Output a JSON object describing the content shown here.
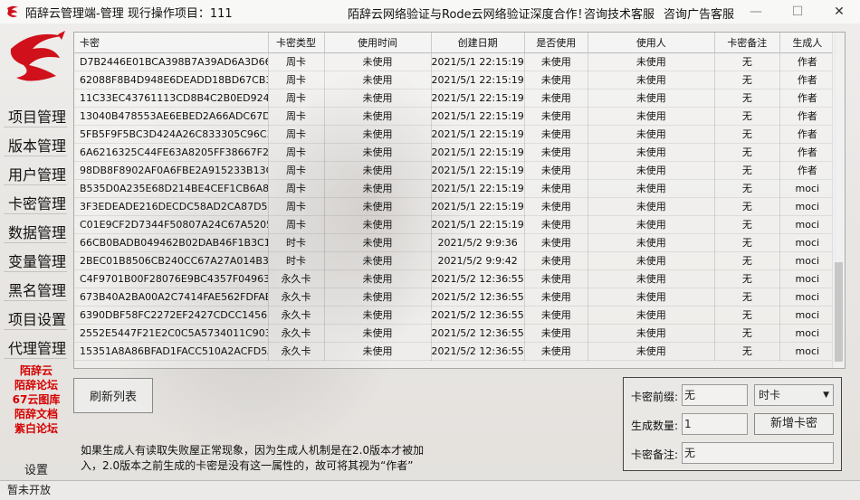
{
  "window": {
    "title": "陌辞云管理端-管理 现行操作项目：111",
    "banner": "陌辞云网络验证与Rode云网络验证深度合作！",
    "support_link": "咨询技术客服",
    "ads_link": "咨询广告客服",
    "minimize": "—",
    "maximize": "☐",
    "close": "✕"
  },
  "sidebar": {
    "items": [
      "项目管理",
      "版本管理",
      "用户管理",
      "卡密管理",
      "数据管理",
      "变量管理",
      "黑名管理",
      "项目设置",
      "代理管理"
    ],
    "links": [
      "陌辞云",
      "陌辞论坛",
      "67云图库",
      "陌辞文档",
      "紫白论坛"
    ],
    "settings": "设置"
  },
  "table": {
    "columns": [
      "卡密",
      "卡密类型",
      "使用时间",
      "创建日期",
      "是否使用",
      "使用人",
      "卡密备注",
      "生成人"
    ],
    "rows": [
      [
        "D7B2446E01BCA398B7A39AD6A3D668F5",
        "周卡",
        "未使用",
        "2021/5/1 22:15:19",
        "未使用",
        "未使用",
        "无",
        "作者"
      ],
      [
        "62088F8B4D948E6DEADD18BD67CB34D…",
        "周卡",
        "未使用",
        "2021/5/1 22:15:19",
        "未使用",
        "未使用",
        "无",
        "作者"
      ],
      [
        "11C33EC43761113CD8B4C2B0ED924091",
        "周卡",
        "未使用",
        "2021/5/1 22:15:19",
        "未使用",
        "未使用",
        "无",
        "作者"
      ],
      [
        "13040B478553AE6EBED2A66ADC67D1ED",
        "周卡",
        "未使用",
        "2021/5/1 22:15:19",
        "未使用",
        "未使用",
        "无",
        "作者"
      ],
      [
        "5FB5F9F5BC3D424A26C833305C96C386",
        "周卡",
        "未使用",
        "2021/5/1 22:15:19",
        "未使用",
        "未使用",
        "无",
        "作者"
      ],
      [
        "6A6216325C44FE63A8205FF38667F2DA",
        "周卡",
        "未使用",
        "2021/5/1 22:15:19",
        "未使用",
        "未使用",
        "无",
        "作者"
      ],
      [
        "98DB8F8902AF0A6FBE2A915233B13C45",
        "周卡",
        "未使用",
        "2021/5/1 22:15:19",
        "未使用",
        "未使用",
        "无",
        "作者"
      ],
      [
        "B535D0A235E68D214BE4CEF1CB6A84A7",
        "周卡",
        "未使用",
        "2021/5/1 22:15:19",
        "未使用",
        "未使用",
        "无",
        "moci"
      ],
      [
        "3F3EDEADE216DECDC58AD2CA87D562…",
        "周卡",
        "未使用",
        "2021/5/1 22:15:19",
        "未使用",
        "未使用",
        "无",
        "moci"
      ],
      [
        "C01E9CF2D7344F50807A24C67A5205B2",
        "周卡",
        "未使用",
        "2021/5/1 22:15:19",
        "未使用",
        "未使用",
        "无",
        "moci"
      ],
      [
        "66CB0BADB049462B02DAB46F1B3C10A6",
        "时卡",
        "未使用",
        "2021/5/2 9:9:36",
        "未使用",
        "未使用",
        "无",
        "moci"
      ],
      [
        "2BEC01B8506CB240CC67A27A014B3E1A",
        "时卡",
        "未使用",
        "2021/5/2 9:9:42",
        "未使用",
        "未使用",
        "无",
        "moci"
      ],
      [
        "C4F9701B00F28076E9BC4357F0496369",
        "永久卡",
        "未使用",
        "2021/5/2 12:36:55",
        "未使用",
        "未使用",
        "无",
        "moci"
      ],
      [
        "673B40A2BA00A2C7414FAE562FDFAED4",
        "永久卡",
        "未使用",
        "2021/5/2 12:36:55",
        "未使用",
        "未使用",
        "无",
        "moci"
      ],
      [
        "6390DBF58FC2272EF2427CDCC1456855",
        "永久卡",
        "未使用",
        "2021/5/2 12:36:55",
        "未使用",
        "未使用",
        "无",
        "moci"
      ],
      [
        "2552E5447F21E2C0C5A5734011C9037F",
        "永久卡",
        "未使用",
        "2021/5/2 12:36:55",
        "未使用",
        "未使用",
        "无",
        "moci"
      ],
      [
        "15351A8A86BFAD1FACC510A2ACFD5A61",
        "永久卡",
        "未使用",
        "2021/5/2 12:36:55",
        "未使用",
        "未使用",
        "无",
        "moci"
      ]
    ]
  },
  "actions": {
    "refresh": "刷新列表",
    "note": "如果生成人有读取失败屋正常现象，因为生成人机制是在2.0版本才被加入，2.0版本之前生成的卡密是没有这一属性的，故可将其视为“作者”"
  },
  "generator": {
    "prefix_label": "卡密前缀:",
    "prefix_value": "无",
    "type_value": "时卡",
    "count_label": "生成数量:",
    "count_value": "1",
    "add_button": "新增卡密",
    "remark_label": "卡密备注:",
    "remark_value": "无"
  },
  "status": {
    "text": "暂未开放"
  }
}
